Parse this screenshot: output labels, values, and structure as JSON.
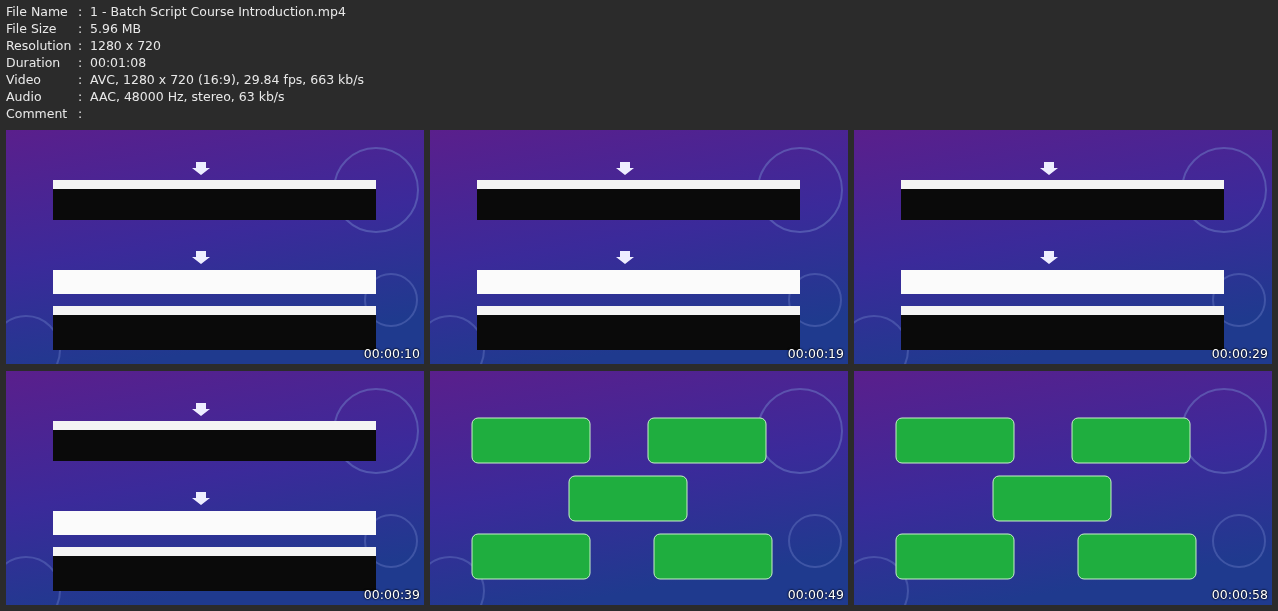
{
  "file_info": [
    {
      "label": "File Name",
      "value": "1 - Batch Script Course Introduction.mp4"
    },
    {
      "label": "File Size",
      "value": "5.96 MB"
    },
    {
      "label": "Resolution",
      "value": "1280 x 720"
    },
    {
      "label": "Duration",
      "value": "00:01:08"
    },
    {
      "label": "Video",
      "value": "AVC, 1280 x 720 (16:9), 29.84 fps, 663 kb/s"
    },
    {
      "label": "Audio",
      "value": "AAC, 48000 Hz, stereo, 63 kb/s"
    },
    {
      "label": "Comment"
    }
  ],
  "separator": ":",
  "thumbnails": [
    {
      "kind": "picture",
      "timestamp": "00:00:10"
    },
    {
      "kind": "picture",
      "timestamp": "00:00:19"
    },
    {
      "kind": "picture",
      "timestamp": "00:00:29"
    },
    {
      "kind": "picture",
      "timestamp": "00:00:39"
    },
    {
      "kind": "picture",
      "timestamp": "00:00:49"
    },
    {
      "kind": "picture",
      "timestamp": "00:00:58"
    }
  ]
}
